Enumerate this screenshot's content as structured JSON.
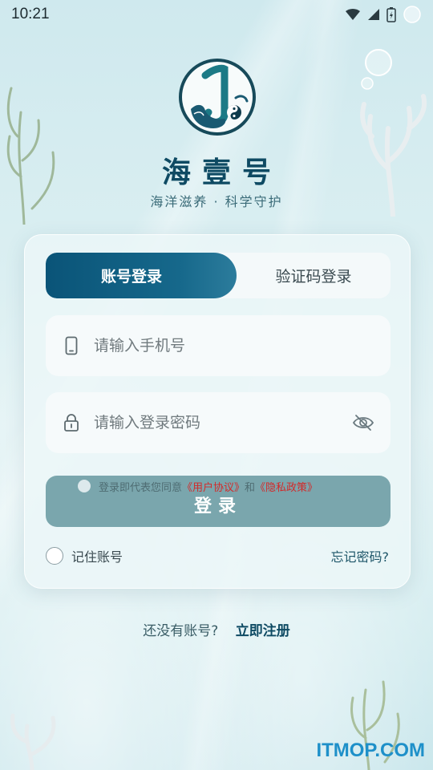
{
  "status_bar": {
    "time": "10:21",
    "icons": [
      "wifi-icon",
      "signal-icon",
      "battery-icon",
      "signal-icon"
    ]
  },
  "brand": {
    "title": "海壹号",
    "subtitle": "海洋滋养 · 科学守护",
    "logo_icon": "brand-logo-icon"
  },
  "tabs": [
    {
      "label": "账号登录",
      "active": true
    },
    {
      "label": "验证码登录",
      "active": false
    }
  ],
  "form": {
    "phone_placeholder": "请输入手机号",
    "phone_icon": "phone-icon",
    "password_placeholder": "请输入登录密码",
    "password_icon": "lock-icon",
    "toggle_icon": "eye-off-icon",
    "login_label": "登录",
    "agreement": {
      "prefix": "登录即代表您同意",
      "user_agreement": "《用户协议》",
      "conjunction": "和",
      "privacy_policy": "《隐私政策》"
    },
    "remember_label": "记住账号",
    "forgot_label": "忘记密码?"
  },
  "register": {
    "question": "还没有账号?",
    "link": "立即注册"
  },
  "watermark": "ITMOP.COM",
  "colors": {
    "brand": "#0e4a63",
    "tab_active": "#0a5478",
    "button": "#7aa6ad",
    "link_red": "#d32a2a",
    "watermark": "#1e90c9"
  }
}
